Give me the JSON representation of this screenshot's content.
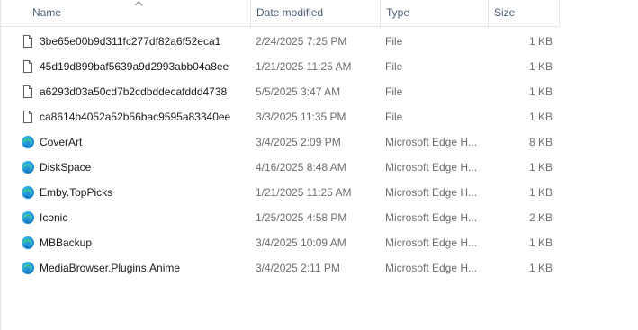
{
  "columns": {
    "name": "Name",
    "date": "Date modified",
    "type": "Type",
    "size": "Size"
  },
  "sort_indicator": "chevron-up-icon",
  "files": [
    {
      "name": "3be65e00b9d311fc277df82a6f52eca1",
      "date": "2/24/2025 7:25 PM",
      "type": "File",
      "size": "1 KB",
      "icon": "file-icon"
    },
    {
      "name": "45d19d899baf5639a9d2993abb04a8ee",
      "date": "1/21/2025 11:25 AM",
      "type": "File",
      "size": "1 KB",
      "icon": "file-icon"
    },
    {
      "name": "a6293d03a50cd7b2cdbddecafddd4738",
      "date": "5/5/2025 3:47 AM",
      "type": "File",
      "size": "1 KB",
      "icon": "file-icon"
    },
    {
      "name": "ca8614b4052a52b56bac9595a83340ee",
      "date": "3/3/2025 11:35 PM",
      "type": "File",
      "size": "1 KB",
      "icon": "file-icon"
    },
    {
      "name": "CoverArt",
      "date": "3/4/2025 2:09 PM",
      "type": "Microsoft Edge H...",
      "size": "8 KB",
      "icon": "edge-icon"
    },
    {
      "name": "DiskSpace",
      "date": "4/16/2025 8:48 AM",
      "type": "Microsoft Edge H...",
      "size": "1 KB",
      "icon": "edge-icon"
    },
    {
      "name": "Emby.TopPicks",
      "date": "1/21/2025 11:25 AM",
      "type": "Microsoft Edge H...",
      "size": "1 KB",
      "icon": "edge-icon"
    },
    {
      "name": "Iconic",
      "date": "1/25/2025 4:58 PM",
      "type": "Microsoft Edge H...",
      "size": "2 KB",
      "icon": "edge-icon"
    },
    {
      "name": "MBBackup",
      "date": "3/4/2025 10:09 AM",
      "type": "Microsoft Edge H...",
      "size": "1 KB",
      "icon": "edge-icon"
    },
    {
      "name": "MediaBrowser.Plugins.Anime",
      "date": "3/4/2025 2:11 PM",
      "type": "Microsoft Edge H...",
      "size": "1 KB",
      "icon": "edge-icon"
    }
  ]
}
